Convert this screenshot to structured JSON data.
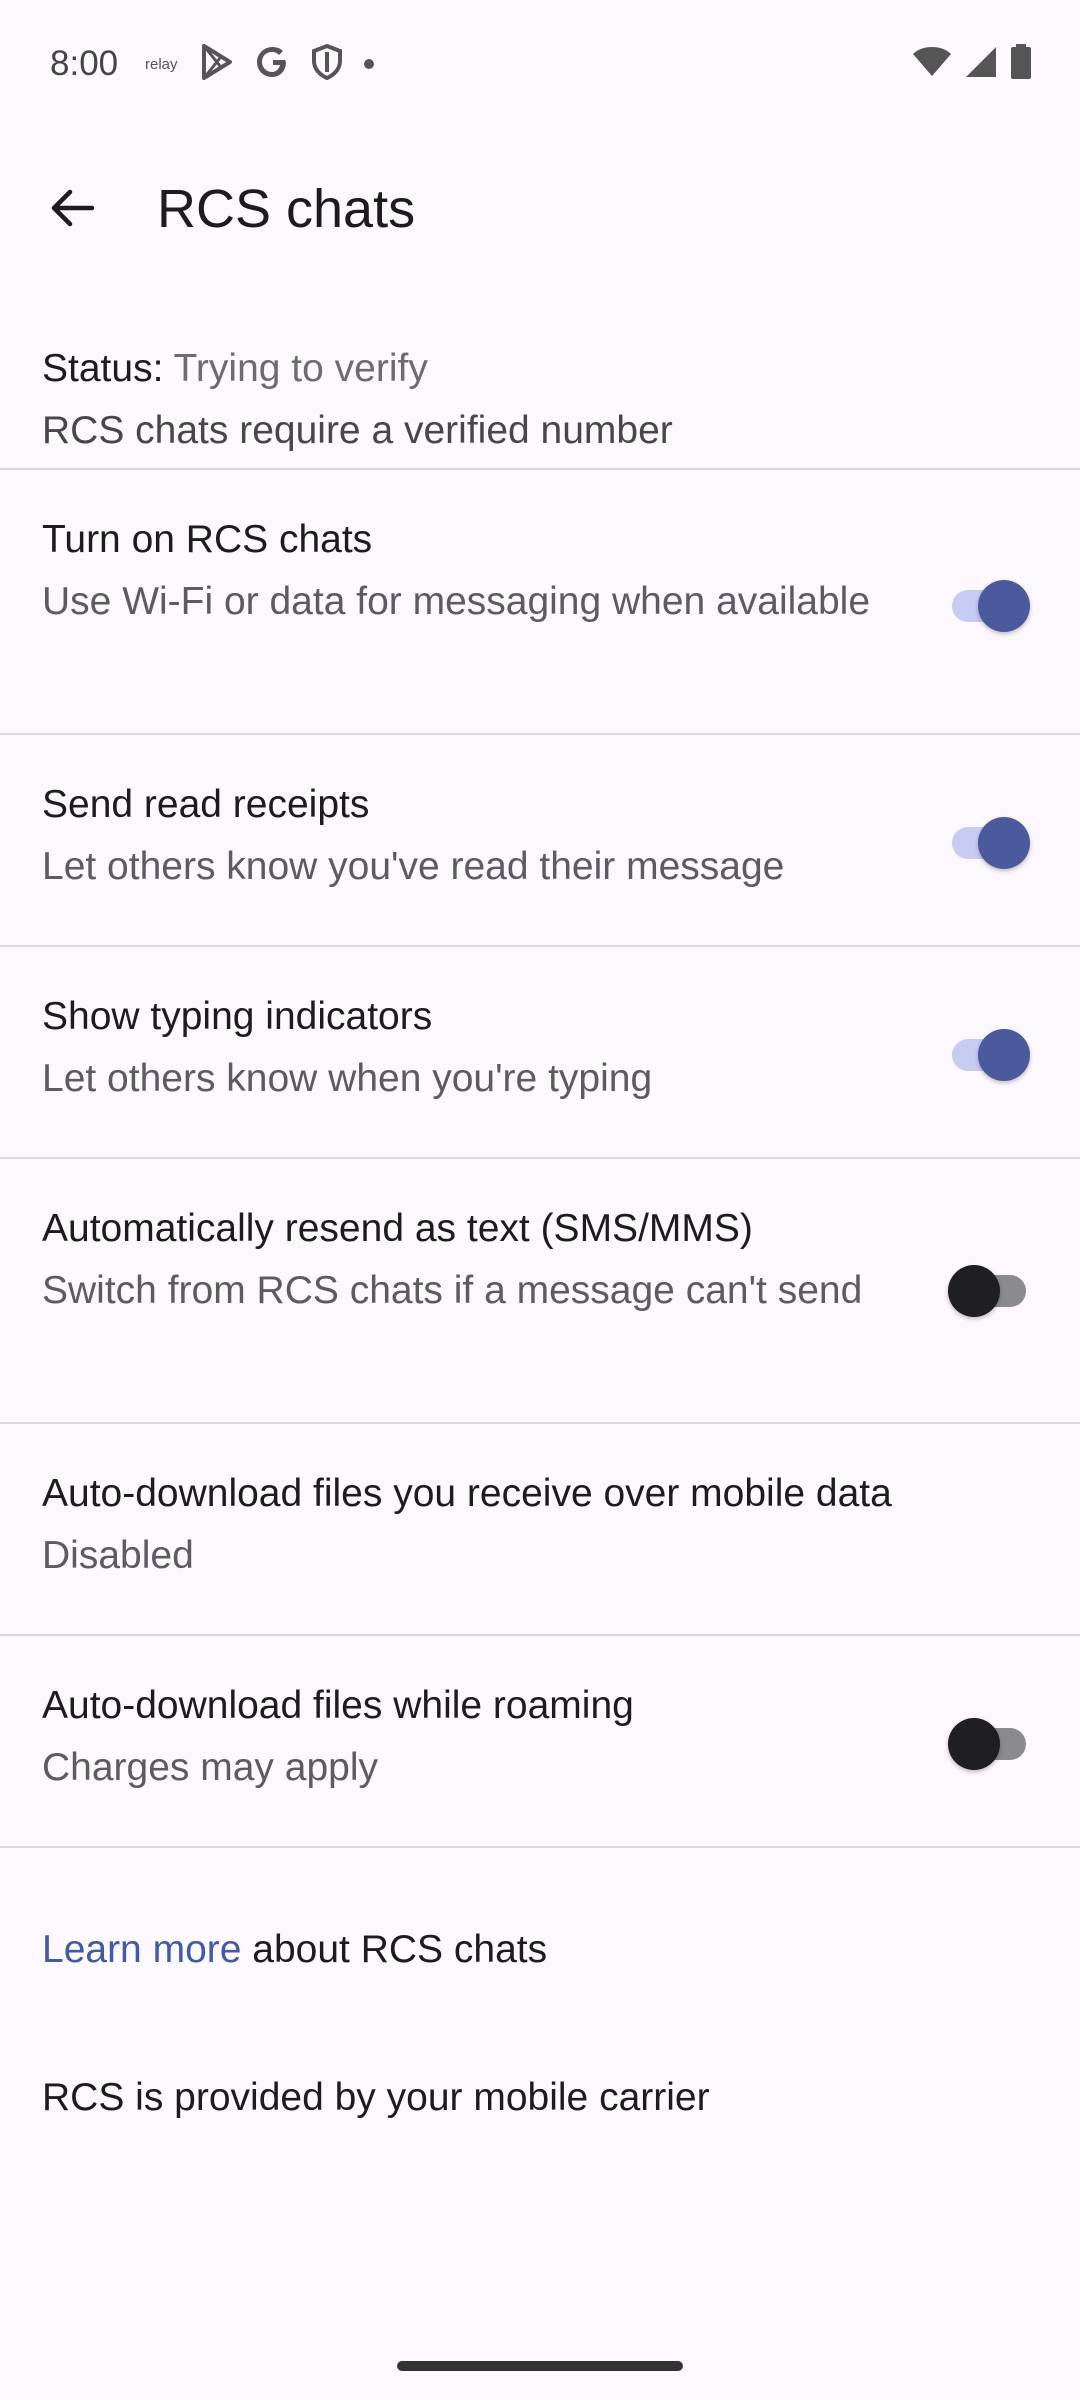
{
  "status_bar": {
    "time": "8:00",
    "left_icons": [
      "amazon-relay-icon",
      "play-store-icon",
      "google-icon",
      "shield-icon",
      "dot-icon"
    ],
    "relay_text": "relay",
    "right_icons": [
      "wifi-icon",
      "signal-icon",
      "battery-icon"
    ]
  },
  "app_bar": {
    "title": "RCS chats",
    "back_icon": "arrow-back-icon"
  },
  "status": {
    "label": "Status:",
    "value": "Trying to verify",
    "description": "RCS chats require a verified number"
  },
  "settings": [
    {
      "title": "Turn on RCS chats",
      "subtitle": "Use Wi-Fi or data for messaging when available",
      "toggle": true
    },
    {
      "title": "Send read receipts",
      "subtitle": "Let others know you've read their message",
      "toggle": true
    },
    {
      "title": "Show typing indicators",
      "subtitle": "Let others know when you're typing",
      "toggle": true
    },
    {
      "title": "Automatically resend as text (SMS/MMS)",
      "subtitle": "Switch from RCS chats if a message can't send",
      "toggle": false
    },
    {
      "title": "Auto-download files you receive over mobile data",
      "subtitle": "Disabled"
    },
    {
      "title": "Auto-download files while roaming",
      "subtitle": "Charges may apply",
      "toggle": false
    }
  ],
  "footer": {
    "learn_more_link": "Learn more",
    "learn_more_rest": " about RCS chats",
    "provider_note": "RCS is provided by your mobile carrier"
  },
  "colors": {
    "background": "#fdf8fd",
    "accent": "#4a5a9c",
    "link": "#3f5aa6"
  }
}
